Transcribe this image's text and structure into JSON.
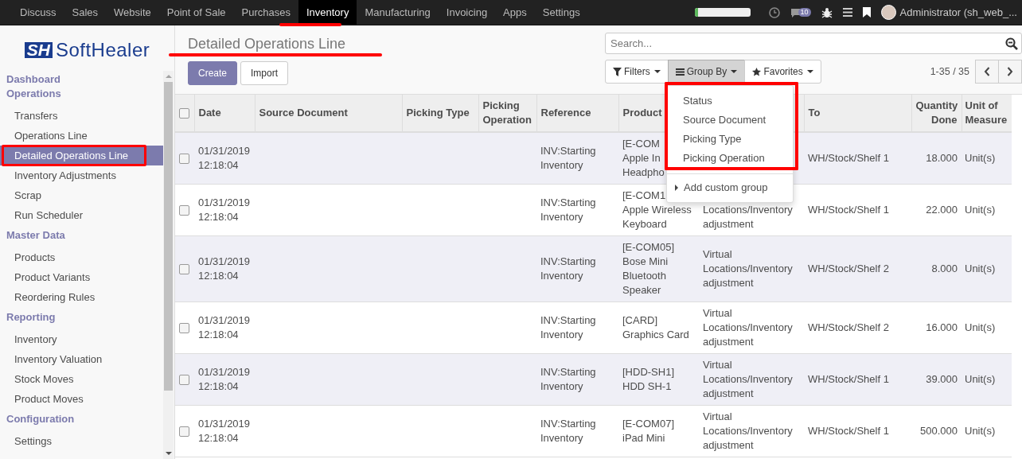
{
  "top_nav": {
    "apps": [
      {
        "label": "Discuss",
        "selected": false
      },
      {
        "label": "Sales",
        "selected": false
      },
      {
        "label": "Website",
        "selected": false
      },
      {
        "label": "Point of Sale",
        "selected": false
      },
      {
        "label": "Purchases",
        "selected": false
      },
      {
        "label": "Inventory",
        "selected": true
      },
      {
        "label": "Manufacturing",
        "selected": false
      },
      {
        "label": "Invoicing",
        "selected": false
      },
      {
        "label": "Apps",
        "selected": false
      },
      {
        "label": "Settings",
        "selected": false
      }
    ],
    "progress": {
      "level": 0.06
    },
    "messages_badge": "10",
    "user": "Administrator (sh_web_..."
  },
  "sidebar": {
    "logo": {
      "mark": "SH",
      "name": "SoftHealer"
    },
    "sections": [
      {
        "title": "Dashboard"
      },
      {
        "title": "Operations",
        "items": [
          {
            "label": "Transfers",
            "selected": false
          },
          {
            "label": "Operations Line",
            "selected": false
          },
          {
            "label": "Detailed Operations Line",
            "selected": true
          },
          {
            "label": "Inventory Adjustments",
            "selected": false
          },
          {
            "label": "Scrap",
            "selected": false
          },
          {
            "label": "Run Scheduler",
            "selected": false
          }
        ]
      },
      {
        "title": "Master Data",
        "items": [
          {
            "label": "Products",
            "selected": false
          },
          {
            "label": "Product Variants",
            "selected": false
          },
          {
            "label": "Reordering Rules",
            "selected": false
          }
        ]
      },
      {
        "title": "Reporting",
        "items": [
          {
            "label": "Inventory",
            "selected": false
          },
          {
            "label": "Inventory Valuation",
            "selected": false
          },
          {
            "label": "Stock Moves",
            "selected": false
          },
          {
            "label": "Product Moves",
            "selected": false
          }
        ]
      },
      {
        "title": "Configuration",
        "items": [
          {
            "label": "Settings",
            "selected": false
          }
        ]
      }
    ]
  },
  "control_panel": {
    "title": "Detailed Operations Line",
    "buttons": [
      {
        "label": "Create",
        "kind": "primary"
      },
      {
        "label": "Import",
        "kind": "secondary"
      }
    ],
    "search": {
      "placeholder": "Search..."
    },
    "search_options": [
      {
        "label": "Filters",
        "selected": false,
        "kind": "filter"
      },
      {
        "label": "Group By",
        "selected": true,
        "kind": "group"
      },
      {
        "label": "Favorites",
        "selected": false,
        "kind": "star"
      }
    ],
    "pager": "1-35 / 35"
  },
  "group_by_menu": {
    "options": [
      "Status",
      "Source Document",
      "Picking Type",
      "Picking Operation"
    ],
    "custom": "Add custom group"
  },
  "table": {
    "all_checked": false,
    "columns": [
      {
        "label": "Date",
        "kind": "text"
      },
      {
        "label": "Source Document",
        "kind": "text"
      },
      {
        "label": "Picking Type",
        "kind": "text"
      },
      {
        "label": "Picking Operation",
        "kind": "text"
      },
      {
        "label": "Reference",
        "kind": "text"
      },
      {
        "label": "Product",
        "kind": "text"
      },
      {
        "kind": "text"
      },
      {
        "label": "To",
        "kind": "text"
      },
      {
        "label": "Quantity Done",
        "kind": "number"
      },
      {
        "label": "Unit of Measure",
        "kind": "text"
      }
    ],
    "rows": [
      {
        "checked": false,
        "cells": [
          "01/31/2019 12:18:04",
          null,
          null,
          null,
          "INV:Starting Inventory",
          "[E-COM\nApple In\nHeadpho",
          null,
          "WH/Stock/Shelf 1",
          "18.000",
          "Unit(s)"
        ]
      },
      {
        "checked": false,
        "cells": [
          "01/31/2019 12:18:04",
          null,
          null,
          null,
          "INV:Starting Inventory",
          "[E-COM1\nApple Wireless Keyboard",
          "Locations/Inventory adjustment",
          "WH/Stock/Shelf 1",
          "22.000",
          "Unit(s)"
        ]
      },
      {
        "checked": false,
        "cells": [
          "01/31/2019 12:18:04",
          null,
          null,
          null,
          "INV:Starting Inventory",
          "[E-COM05] Bose Mini Bluetooth Speaker",
          "Virtual Locations/Inventory adjustment",
          "WH/Stock/Shelf 2",
          "8.000",
          "Unit(s)"
        ]
      },
      {
        "checked": false,
        "cells": [
          "01/31/2019 12:18:04",
          null,
          null,
          null,
          "INV:Starting Inventory",
          "[CARD] Graphics Card",
          "Virtual Locations/Inventory adjustment",
          "WH/Stock/Shelf 2",
          "16.000",
          "Unit(s)"
        ]
      },
      {
        "checked": false,
        "cells": [
          "01/31/2019 12:18:04",
          null,
          null,
          null,
          "INV:Starting Inventory",
          "[HDD-SH1] HDD SH-1",
          "Virtual Locations/Inventory adjustment",
          "WH/Stock/Shelf 1",
          "39.000",
          "Unit(s)"
        ]
      },
      {
        "checked": false,
        "cells": [
          "01/31/2019 12:18:04",
          null,
          null,
          null,
          "INV:Starting Inventory",
          "[E-COM07] iPad Mini",
          "Virtual Locations/Inventory adjustment",
          "WH/Stock/Shelf 1",
          "500.000",
          "Unit(s)"
        ]
      }
    ]
  }
}
